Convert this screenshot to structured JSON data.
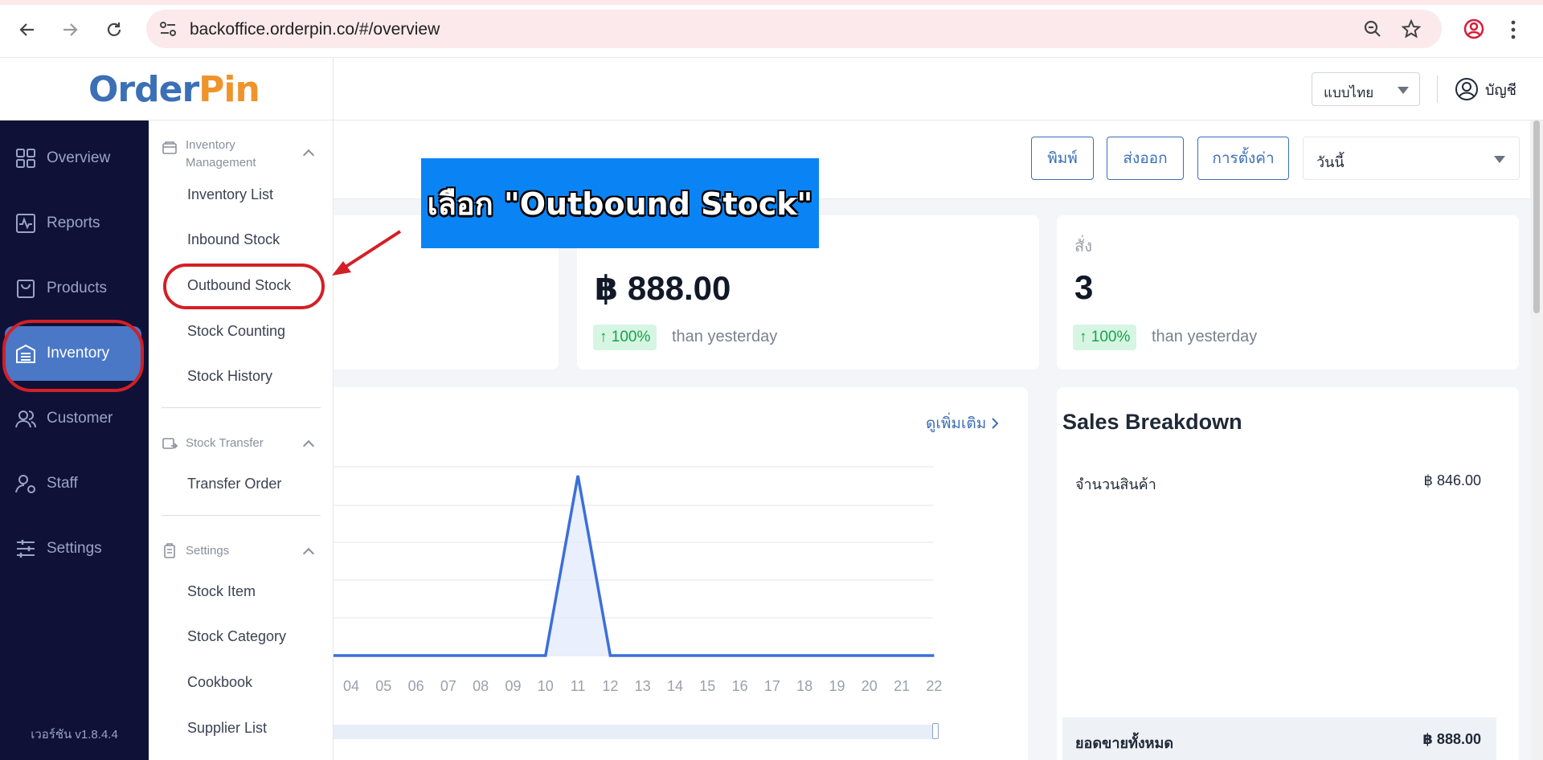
{
  "browser": {
    "url": "backoffice.orderpin.co/#/overview"
  },
  "header": {
    "logo_part1": "Order",
    "logo_part2": "Pin",
    "language": "แบบไทย",
    "account_label": "บัญชี"
  },
  "sidebar": {
    "items": [
      {
        "label": "Overview",
        "icon": "grid-icon"
      },
      {
        "label": "Reports",
        "icon": "chart-pulse-icon"
      },
      {
        "label": "Products",
        "icon": "shopping-bag-icon"
      },
      {
        "label": "Inventory",
        "icon": "warehouse-icon"
      },
      {
        "label": "Customer",
        "icon": "users-icon"
      },
      {
        "label": "Staff",
        "icon": "user-gear-icon"
      },
      {
        "label": "Settings",
        "icon": "sliders-icon"
      }
    ],
    "active": "Inventory",
    "version": "เวอร์ชัน v1.8.4.4"
  },
  "submenu": {
    "sections": [
      {
        "title": "Inventory Management",
        "items": [
          "Inventory List",
          "Inbound Stock",
          "Outbound Stock",
          "Stock Counting",
          "Stock History"
        ]
      },
      {
        "title": "Stock Transfer",
        "items": [
          "Transfer Order"
        ]
      },
      {
        "title": "Settings",
        "items": [
          "Stock Item",
          "Stock Category",
          "Cookbook",
          "Supplier List"
        ]
      }
    ],
    "inventory_title_line1": "Inventory",
    "inventory_title_line2": "Management",
    "highlighted": "Outbound Stock"
  },
  "toolbar": {
    "print_label": "พิมพ์",
    "export_label": "ส่งออก",
    "settings_label": "การตั้งค่า",
    "date_range": "วันนี้"
  },
  "cards": [
    {
      "label": "",
      "value": "฿ 888.00",
      "pct": "↑ 100%",
      "compare": "than yesterday"
    },
    {
      "label": "สั่ง",
      "value": "3",
      "pct": "↑ 100%",
      "compare": "than yesterday"
    }
  ],
  "chart": {
    "see_more": "ดูเพิ่มเติม"
  },
  "chart_data": {
    "type": "area",
    "x": [
      "04",
      "05",
      "06",
      "07",
      "08",
      "09",
      "10",
      "11",
      "12",
      "13",
      "14",
      "15",
      "16",
      "17",
      "18",
      "19",
      "20",
      "21",
      "22"
    ],
    "values": [
      0,
      0,
      0,
      0,
      0,
      0,
      0,
      888,
      0,
      0,
      0,
      0,
      0,
      0,
      0,
      0,
      0,
      0,
      0
    ],
    "color": "#3b6fd9",
    "grid": true
  },
  "sales": {
    "title": "Sales Breakdown",
    "rows": [
      {
        "label": "จำนวนสินค้า",
        "value": "฿ 846.00"
      }
    ],
    "total_label": "ยอดขายทั้งหมด",
    "total_value": "฿ 888.00"
  },
  "annotation": {
    "text": "เลือก \"Outbound Stock\"",
    "color": "#d41f26"
  }
}
